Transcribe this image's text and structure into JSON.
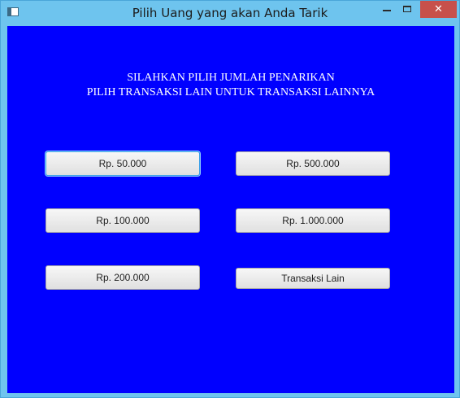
{
  "window": {
    "title": "Pilih Uang yang akan Anda Tarik",
    "close_glyph": "✕"
  },
  "heading": {
    "line1": "SILAHKAN PILIH JUMLAH PENARIKAN",
    "line2": "PILIH TRANSAKSI LAIN UNTUK TRANSAKSI LAINNYA"
  },
  "buttons": {
    "amount_50k": "Rp. 50.000",
    "amount_500k": "Rp. 500.000",
    "amount_100k": "Rp. 100.000",
    "amount_1m": "Rp. 1.000.000",
    "amount_200k": "Rp. 200.000",
    "other_transaction": "Transaksi Lain"
  },
  "colors": {
    "background": "#0000ff",
    "titlebar": "#6ec4ee",
    "close_button": "#c7504b",
    "focus_ring": "#3aa0e8"
  },
  "focused_button": "amount_50k"
}
